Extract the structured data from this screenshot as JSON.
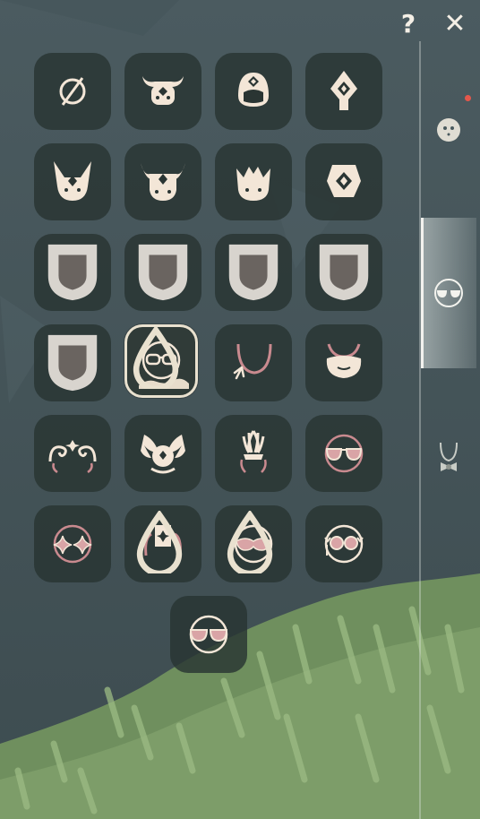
{
  "top_bar": {
    "help_label": "?",
    "close_label": "✕"
  },
  "colors": {
    "cell_bg": "#2a3533",
    "icon_cream": "#f3e6d7",
    "icon_pink": "#d9a4a6",
    "locked_tint": "#8b7f7a",
    "selected_border": "#e9e1cf",
    "notify_dot": "#e4574b"
  },
  "grid": {
    "items": [
      {
        "icon": "none-icon",
        "locked": false
      },
      {
        "icon": "bull-horn-mask-icon",
        "locked": false
      },
      {
        "icon": "tiara-mask-icon",
        "locked": false
      },
      {
        "icon": "diamond-crest-icon",
        "locked": false
      },
      {
        "icon": "fox-horn-mask-icon",
        "locked": false
      },
      {
        "icon": "demon-horn-mask-icon",
        "locked": false
      },
      {
        "icon": "crown-mask-icon",
        "locked": false
      },
      {
        "icon": "diamond-helm-icon",
        "locked": false
      },
      {
        "icon": "horned-crown-locked-icon",
        "locked": true
      },
      {
        "icon": "helmet-locked-icon",
        "locked": true
      },
      {
        "icon": "diamond-locked-icon",
        "locked": true
      },
      {
        "icon": "feather-locked-icon",
        "locked": true
      },
      {
        "icon": "bolt-locked-icon",
        "locked": true
      },
      {
        "icon": "round-glasses-icon",
        "locked": false,
        "selected": true,
        "dyeable": true
      },
      {
        "icon": "necklace-icon",
        "locked": false
      },
      {
        "icon": "bib-icon",
        "locked": false
      },
      {
        "icon": "swirl-horns-icon",
        "locked": false
      },
      {
        "icon": "wing-crest-icon",
        "locked": false
      },
      {
        "icon": "plume-headdress-icon",
        "locked": false
      },
      {
        "icon": "pink-sunglasses-icon",
        "locked": false
      },
      {
        "icon": "star-glasses-icon",
        "locked": false
      },
      {
        "icon": "card-headphones-icon",
        "locked": false,
        "dyeable": true
      },
      {
        "icon": "masquerade-mask-icon",
        "locked": false,
        "dyeable": true
      },
      {
        "icon": "jeweled-glasses-icon",
        "locked": false
      },
      {
        "icon": "pink-shades-icon",
        "locked": false
      }
    ]
  },
  "side_tabs": [
    {
      "icon": "face-icon",
      "active": false,
      "notify": true
    },
    {
      "icon": "glasses-icon",
      "active": true,
      "notify": false
    },
    {
      "icon": "necklace-bow-icon",
      "active": false,
      "notify": false
    }
  ]
}
